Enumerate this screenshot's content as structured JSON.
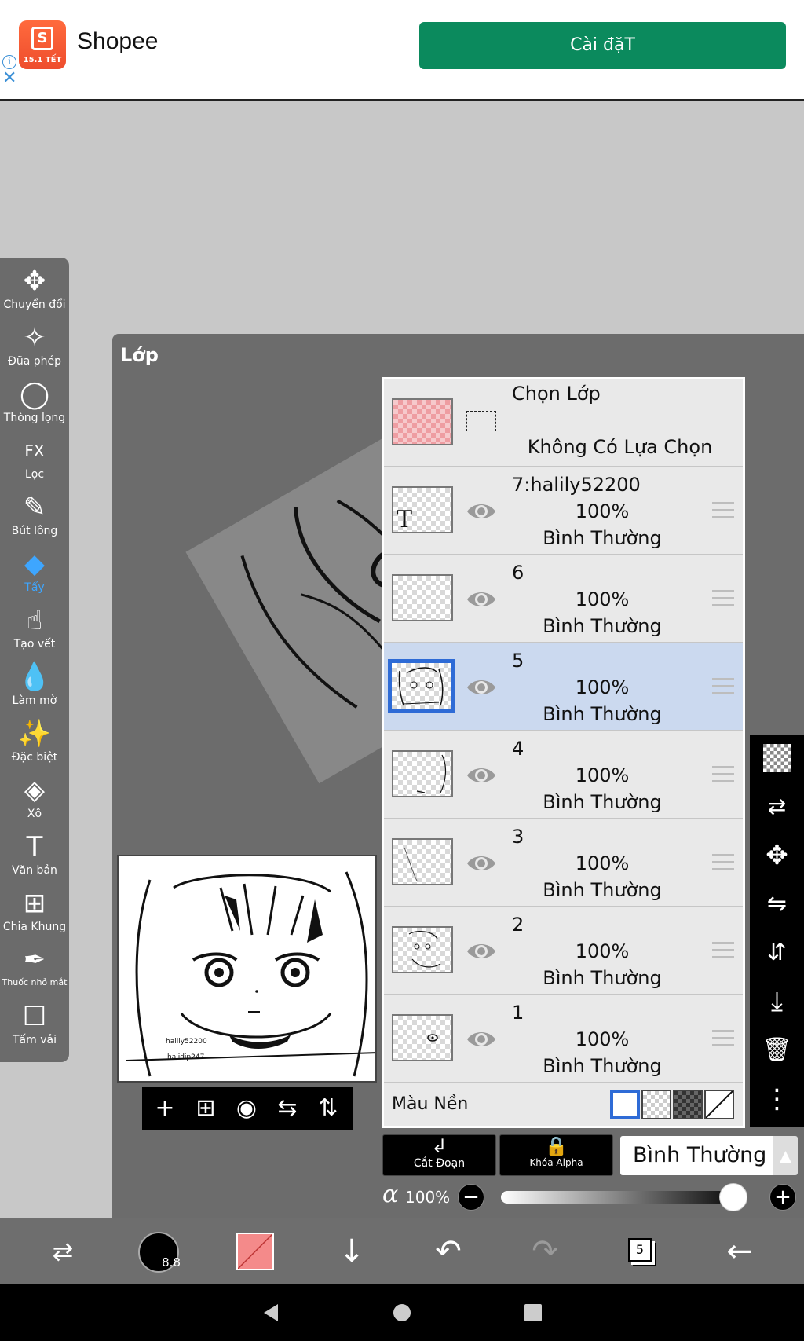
{
  "ad": {
    "app_name": "Shopee",
    "logo_tag": "15.1 TẾT",
    "logo_letter": "S",
    "install_label": "Cài đặT",
    "button_color": "#0b8a5d"
  },
  "tools": [
    {
      "icon": "move-icon",
      "glyph": "✥",
      "label": "Chuyển đổi"
    },
    {
      "icon": "magic-wand-icon",
      "glyph": "✧",
      "label": "Đũa phép"
    },
    {
      "icon": "lasso-icon",
      "glyph": "◯",
      "label": "Thòng lọng"
    },
    {
      "icon": "fx-icon",
      "glyph": "FX",
      "label": "Lọc"
    },
    {
      "icon": "brush-icon",
      "glyph": "✎",
      "label": "Bút lông"
    },
    {
      "icon": "eraser-icon",
      "glyph": "◆",
      "label": "Tẩy"
    },
    {
      "icon": "smudge-icon",
      "glyph": "☝",
      "label": "Tạo vết"
    },
    {
      "icon": "blur-drop-icon",
      "glyph": "💧",
      "label": "Làm mờ"
    },
    {
      "icon": "special-icon",
      "glyph": "✨",
      "label": "Đặc biệt"
    },
    {
      "icon": "bucket-icon",
      "glyph": "◈",
      "label": "Xô"
    },
    {
      "icon": "text-icon",
      "glyph": "T",
      "label": "Văn bản"
    },
    {
      "icon": "frame-divider-icon",
      "glyph": "⊞",
      "label": "Chia Khung"
    },
    {
      "icon": "eyedropper-icon",
      "glyph": "✒",
      "label": "Thuốc nhỏ mắt"
    },
    {
      "icon": "canvas-icon",
      "glyph": "☐",
      "label": "Tấm vải"
    }
  ],
  "active_tool": "Tẩy",
  "panel": {
    "title": "Lớp"
  },
  "preview": {
    "watermark_1": "halily52200",
    "watermark_2": "halidip247"
  },
  "selection_row": {
    "title": "Chọn Lớp",
    "status": "Không Có Lựa Chọn"
  },
  "layers": [
    {
      "name": "7:halily52200",
      "opacity": "100%",
      "mode": "Bình Thường",
      "selected": false
    },
    {
      "name": "6",
      "opacity": "100%",
      "mode": "Bình Thường",
      "selected": false
    },
    {
      "name": "5",
      "opacity": "100%",
      "mode": "Bình Thường",
      "selected": true
    },
    {
      "name": "4",
      "opacity": "100%",
      "mode": "Bình Thường",
      "selected": false
    },
    {
      "name": "3",
      "opacity": "100%",
      "mode": "Bình Thường",
      "selected": false
    },
    {
      "name": "2",
      "opacity": "100%",
      "mode": "Bình Thường",
      "selected": false
    },
    {
      "name": "1",
      "opacity": "100%",
      "mode": "Bình Thường",
      "selected": false
    }
  ],
  "background": {
    "label": "Màu Nền",
    "swatches": [
      "white",
      "transparent-checker",
      "dark-checker",
      "none"
    ]
  },
  "actions": {
    "clip_label": "Cắt Đoạn",
    "alpha_lock_label": "Khóa Alpha",
    "blend_mode": "Bình Thường",
    "alpha_symbol": "α",
    "alpha_value": "100%",
    "alpha_level": 1.0
  },
  "right_toolbar": [
    "checker-icon",
    "swap-layer-icon",
    "move-layer-icon",
    "flip-horizontal-icon",
    "flip-vertical-icon",
    "merge-down-icon",
    "trash-icon",
    "more-icon"
  ],
  "bottom": {
    "brush_size": "8.8",
    "layer_count": "5",
    "color": "#f48a8a"
  }
}
